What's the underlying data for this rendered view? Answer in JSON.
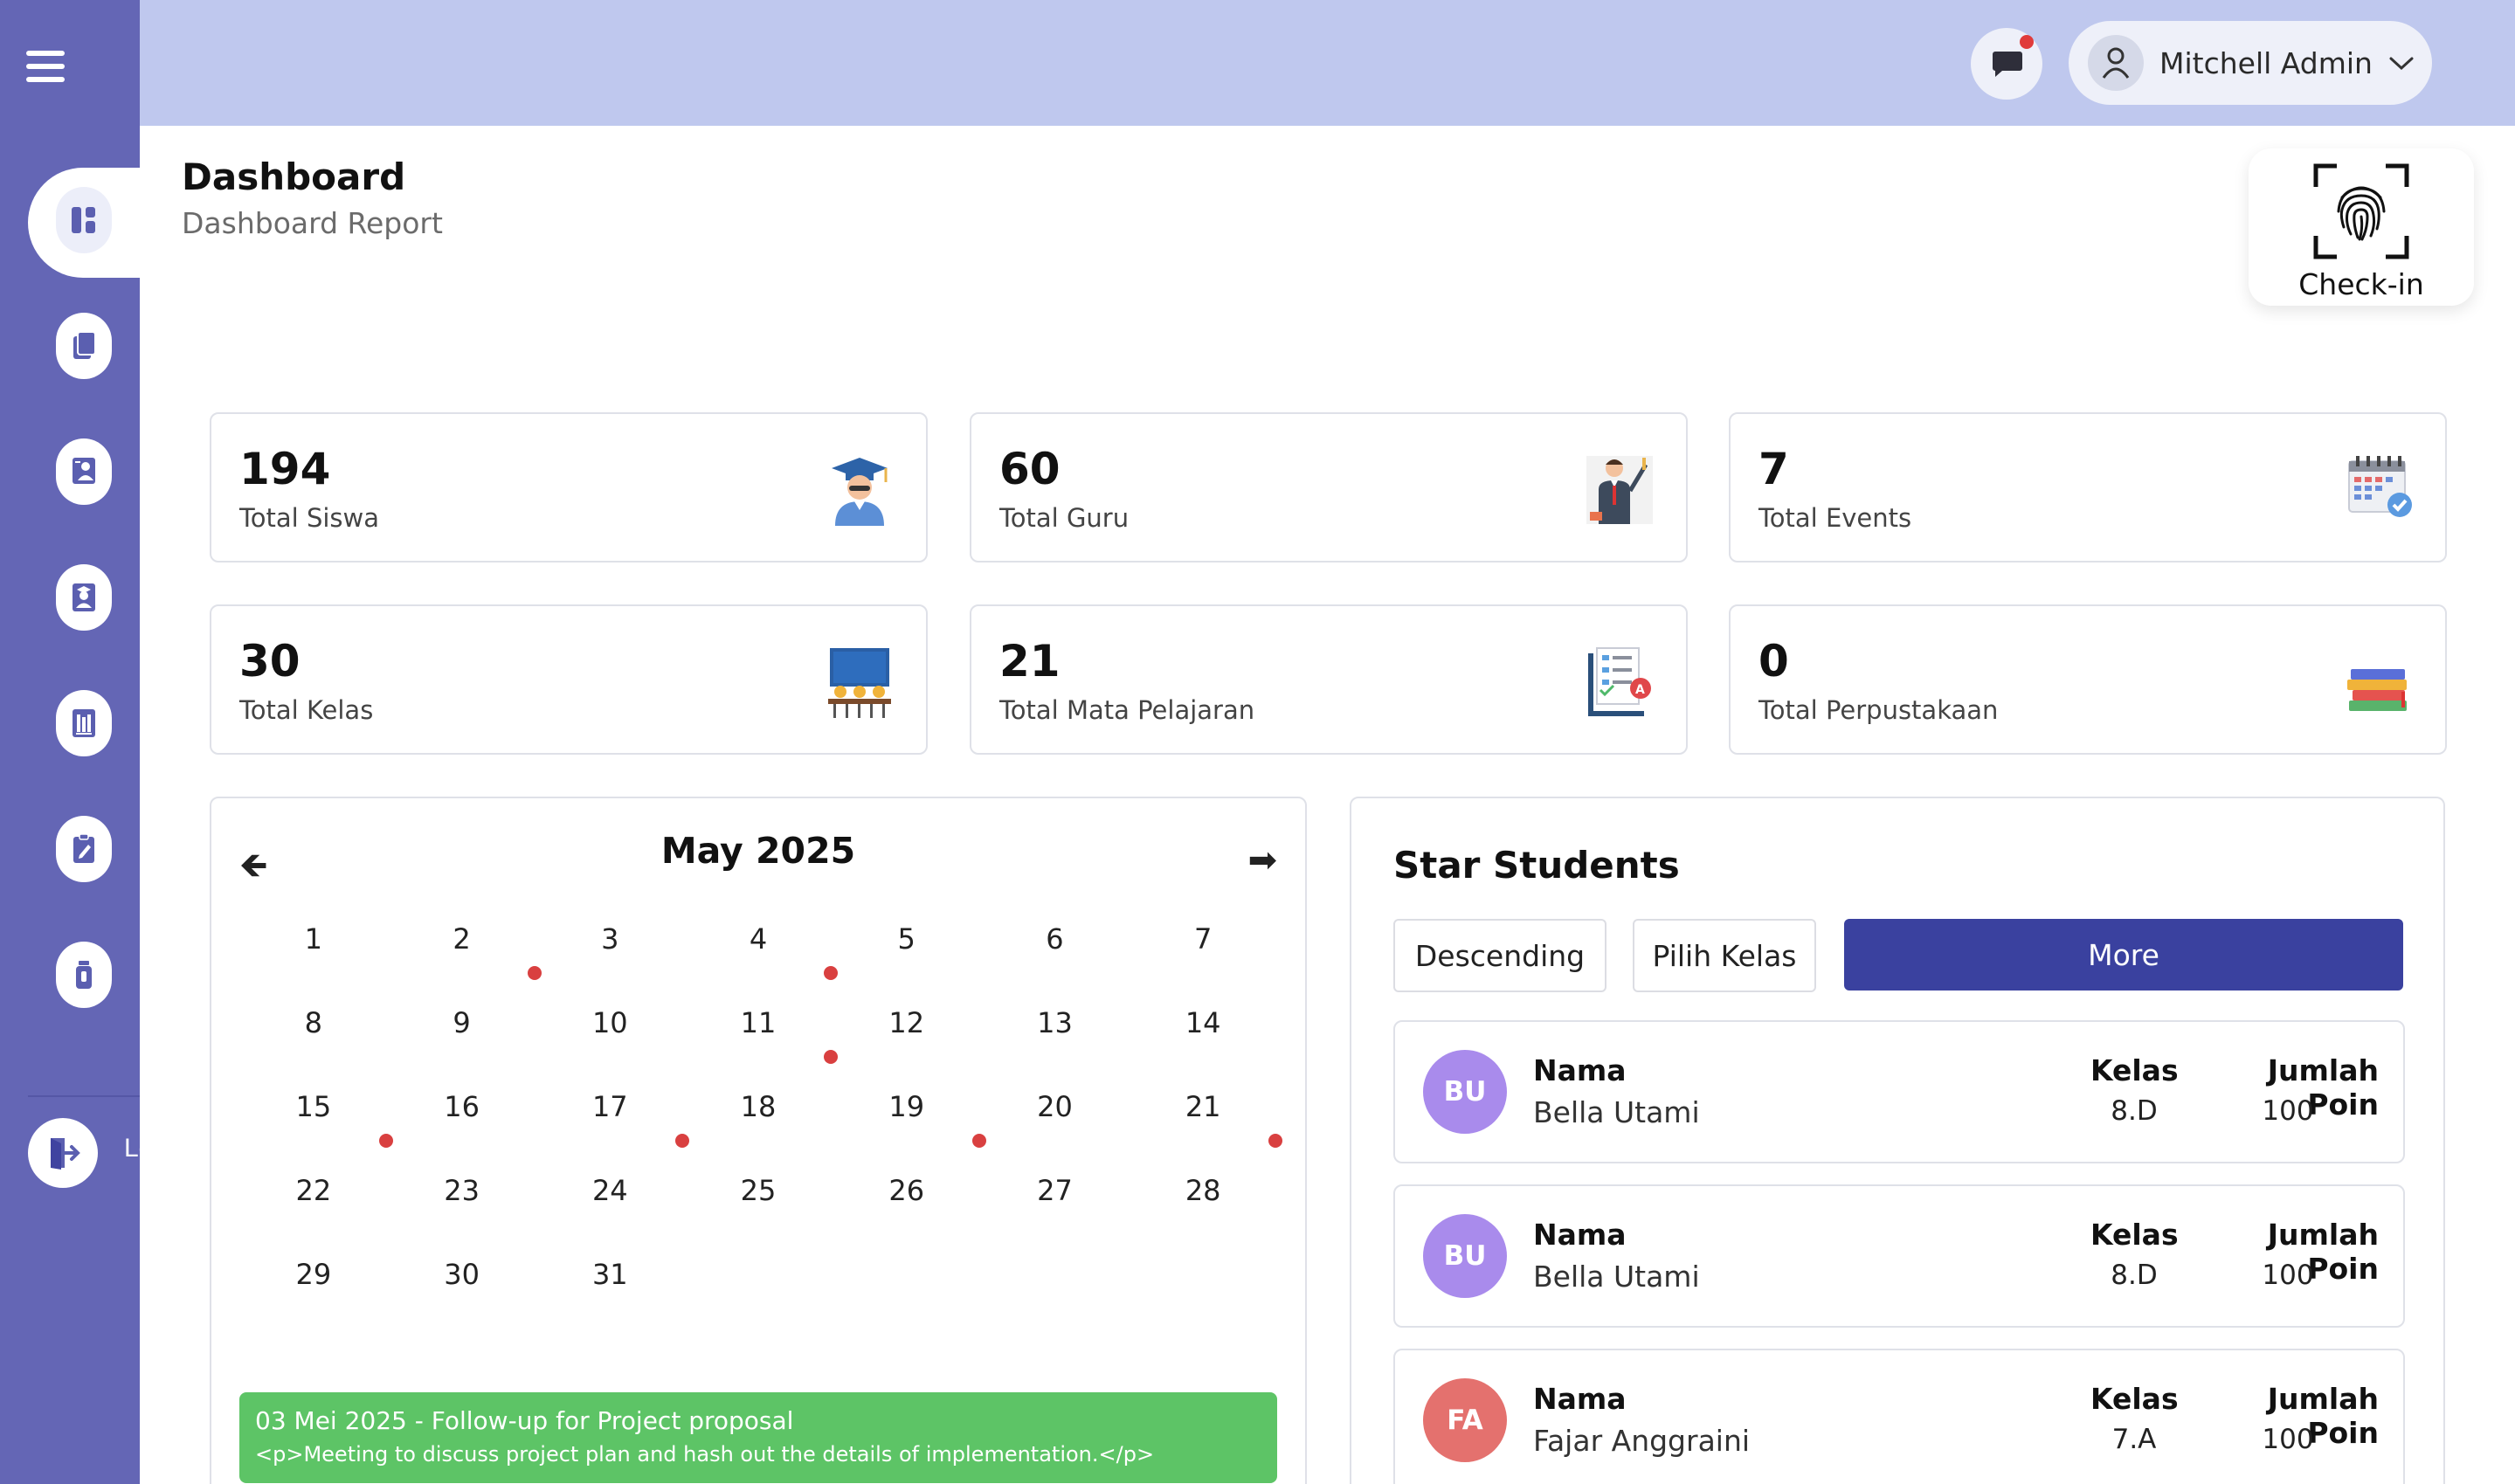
{
  "topbar": {
    "user_name": "Mitchell Admin",
    "has_notification": true
  },
  "sidebar": {
    "items": [
      {
        "name": "dashboard",
        "icon": "dashboard-icon",
        "active": true
      },
      {
        "name": "documents",
        "icon": "document-icon"
      },
      {
        "name": "teachers",
        "icon": "teacher-icon"
      },
      {
        "name": "students",
        "icon": "student-icon"
      },
      {
        "name": "library",
        "icon": "books-icon"
      },
      {
        "name": "tasks",
        "icon": "clipboard-icon"
      },
      {
        "name": "other",
        "icon": "bottle-icon"
      }
    ],
    "logout_label": "Logout"
  },
  "header": {
    "title": "Dashboard",
    "subtitle": "Dashboard Report"
  },
  "checkin": {
    "label": "Check-in"
  },
  "stats": [
    {
      "value": "194",
      "label": "Total Siswa",
      "icon": "graduate-icon"
    },
    {
      "value": "60",
      "label": "Total Guru",
      "icon": "teacher-board-icon"
    },
    {
      "value": "7",
      "label": "Total Events",
      "icon": "calendar-check-icon"
    },
    {
      "value": "30",
      "label": "Total Kelas",
      "icon": "classroom-icon"
    },
    {
      "value": "21",
      "label": "Total Mata Pelajaran",
      "icon": "subject-list-icon"
    },
    {
      "value": "0",
      "label": "Total Perpustakaan",
      "icon": "books-stack-icon"
    }
  ],
  "calendar": {
    "month_label": "May 2025",
    "prev": "🡸",
    "next": "➡",
    "weeks": [
      [
        "1",
        "2",
        "3",
        "4",
        "5",
        "6",
        "7"
      ],
      [
        "8",
        "9",
        "10",
        "11",
        "12",
        "13",
        "14"
      ],
      [
        "15",
        "16",
        "17",
        "18",
        "19",
        "20",
        "21"
      ],
      [
        "22",
        "23",
        "24",
        "25",
        "26",
        "27",
        "28"
      ],
      [
        "29",
        "30",
        "31",
        "",
        "",
        "",
        ""
      ]
    ],
    "event_dates": [
      "2",
      "4",
      "11",
      "15",
      "17",
      "19",
      "21"
    ],
    "event": {
      "title": "03 Mei 2025 - Follow-up for Project proposal",
      "description": "<p>Meeting to discuss project plan and hash out the details of implementation.</p>"
    }
  },
  "stars": {
    "title": "Star Students",
    "sort_label": "Descending",
    "class_label": "Pilih Kelas",
    "more_label": "More",
    "headers": {
      "nama": "Nama",
      "kelas": "Kelas",
      "poin": "Jumlah Poin"
    },
    "students": [
      {
        "initials": "BU",
        "name": "Bella Utami",
        "kelas": "8.D",
        "poin": "100",
        "color": "#a98bec"
      },
      {
        "initials": "BU",
        "name": "Bella Utami",
        "kelas": "8.D",
        "poin": "100",
        "color": "#a98bec"
      },
      {
        "initials": "FA",
        "name": "Fajar Anggraini",
        "kelas": "7.A",
        "poin": "100",
        "color": "#e4716e"
      }
    ]
  },
  "colors": {
    "sidebar": "#6466b5",
    "topbar": "#bfc8ee",
    "accent": "#3a419f",
    "event": "#5dc466",
    "dot": "#d94040"
  }
}
